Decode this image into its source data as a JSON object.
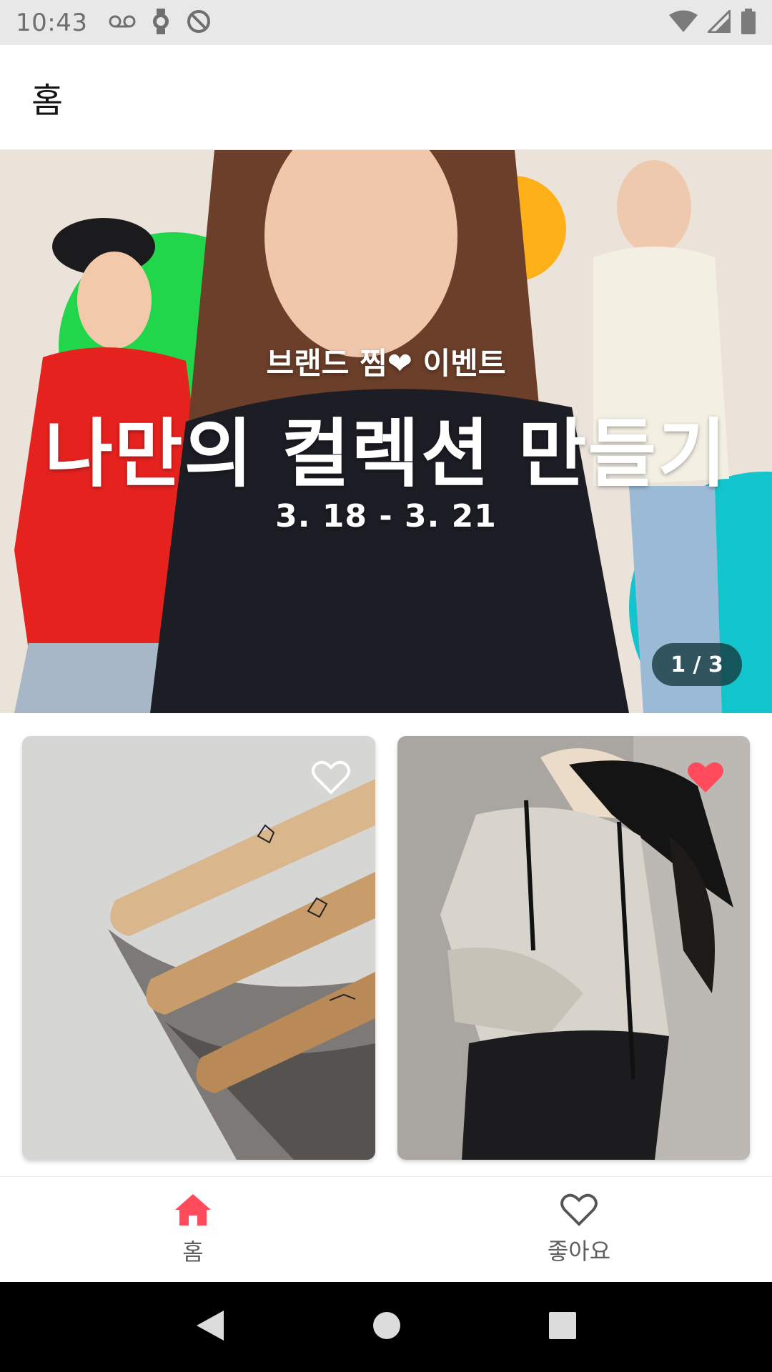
{
  "status_bar": {
    "time": "10:43",
    "left_icons": [
      "voicemail-icon",
      "watch-icon",
      "do-not-disturb-icon"
    ],
    "right_icons": [
      "wifi-icon",
      "signal-icon",
      "battery-icon"
    ]
  },
  "app_bar": {
    "title": "홈"
  },
  "banner": {
    "subtitle": "브랜드 찜❤ 이벤트",
    "heading": "나만의 컬렉션 만들기",
    "dates": "3. 18 - 3. 21",
    "counter": "1 / 3"
  },
  "products": [
    {
      "image": "wooden-constellation-boards",
      "liked": false,
      "icon": "heart-outline-icon"
    },
    {
      "image": "hooded-jacket-with-bag",
      "liked": true,
      "icon": "heart-filled-icon"
    }
  ],
  "bottom_nav": {
    "items": [
      {
        "label": "홈",
        "icon": "home-icon",
        "active": true
      },
      {
        "label": "좋아요",
        "icon": "heart-outline-icon",
        "active": false
      }
    ]
  },
  "colors": {
    "accent": "#ff4b5c",
    "status_bar_bg": "#e8e8e8",
    "nav_bar_bg": "#000000"
  }
}
